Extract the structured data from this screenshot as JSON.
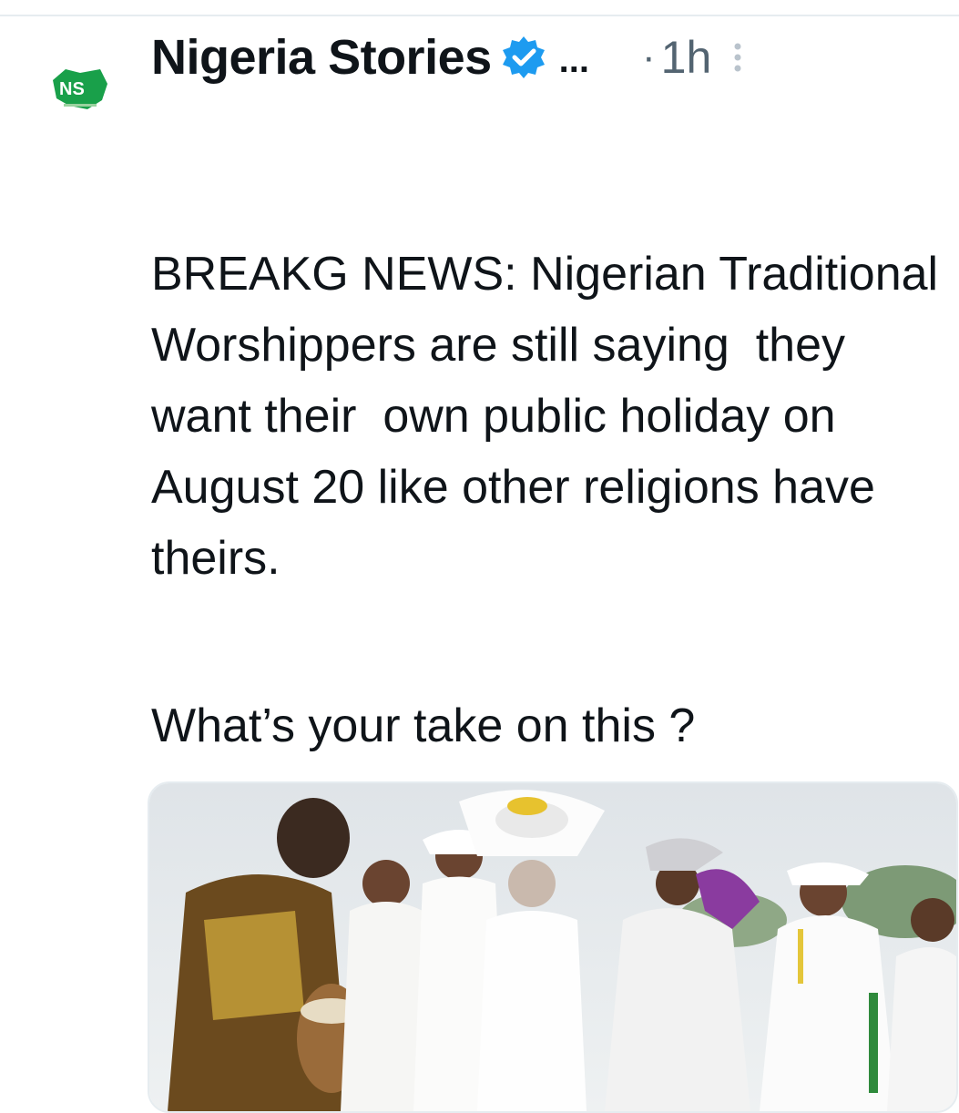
{
  "author": {
    "name": "Nigeria Stories",
    "overflow": "...",
    "separator": "·",
    "time": "1h",
    "avatar_logo_text": "NS",
    "avatar_icon": "nigeria-stories-logo",
    "verified_icon": "verified-badge-icon"
  },
  "tweet": {
    "body": "BREAKG NEWS: Nigerian Traditional Worshippers are still saying  they want their  own public holiday on August 20 like other religions have theirs.",
    "question": "What’s your take on this ?"
  },
  "media": {
    "icon": "photo-traditional-worshippers"
  },
  "colors": {
    "verified": "#1d9bf0",
    "logo_green": "#19a04a",
    "muted": "#536471",
    "text": "#0f1419"
  }
}
